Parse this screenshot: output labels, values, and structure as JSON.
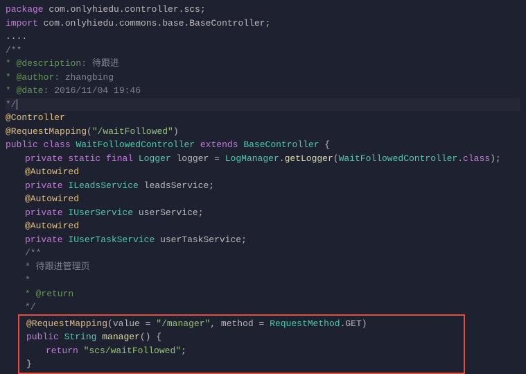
{
  "code": {
    "pkg_kw": "package",
    "pkg_name": "com.onlyhiedu.controller.scs",
    "import_kw": "import",
    "import_name": "com.onlyhiedu.commons.base.BaseController",
    "dots": "....",
    "doc_start": "/**",
    "doc_desc_tag": " * @description",
    "doc_desc_val": ": 待跟进",
    "doc_author_tag": " * @author",
    "doc_author_val": ": zhangbing",
    "doc_date_tag": " * @date",
    "doc_date_val": ": 2016/11/04 ",
    "doc_date_time": "19:46",
    "doc_end": " */",
    "ann_controller": "@Controller",
    "ann_reqmap": "@RequestMapping",
    "reqmap_val": "\"/waitFollowed\"",
    "public": "public",
    "class": "class",
    "classname": "WaitFollowedController",
    "extends": "extends",
    "baseclass": "BaseController",
    "private": "private",
    "static": "static",
    "final": "final",
    "logger_type": "Logger",
    "logger_name": "logger",
    "logmanager": "LogManager",
    "getlogger": "getLogger",
    "class_suffix": "class",
    "autowired": "@Autowired",
    "ileads": "ILeadsService",
    "leads_field": "leadsService",
    "iuser": "IUserService",
    "user_field": "userService",
    "iut": "IUserTaskService",
    "ut_field": "userTaskService",
    "inner_doc_start": "/**",
    "inner_doc_desc": " * 待跟进管理页",
    "inner_doc_star": " *",
    "inner_doc_ret": " * @return",
    "inner_doc_end": " */",
    "value_key": "value",
    "value_str": "\"/manager\"",
    "method_key": "method",
    "reqmethod": "RequestMethod",
    "get": "GET",
    "string_type": "String",
    "manager": "manager",
    "return_kw": "return",
    "return_str": "\"scs/waitFollowed\""
  }
}
